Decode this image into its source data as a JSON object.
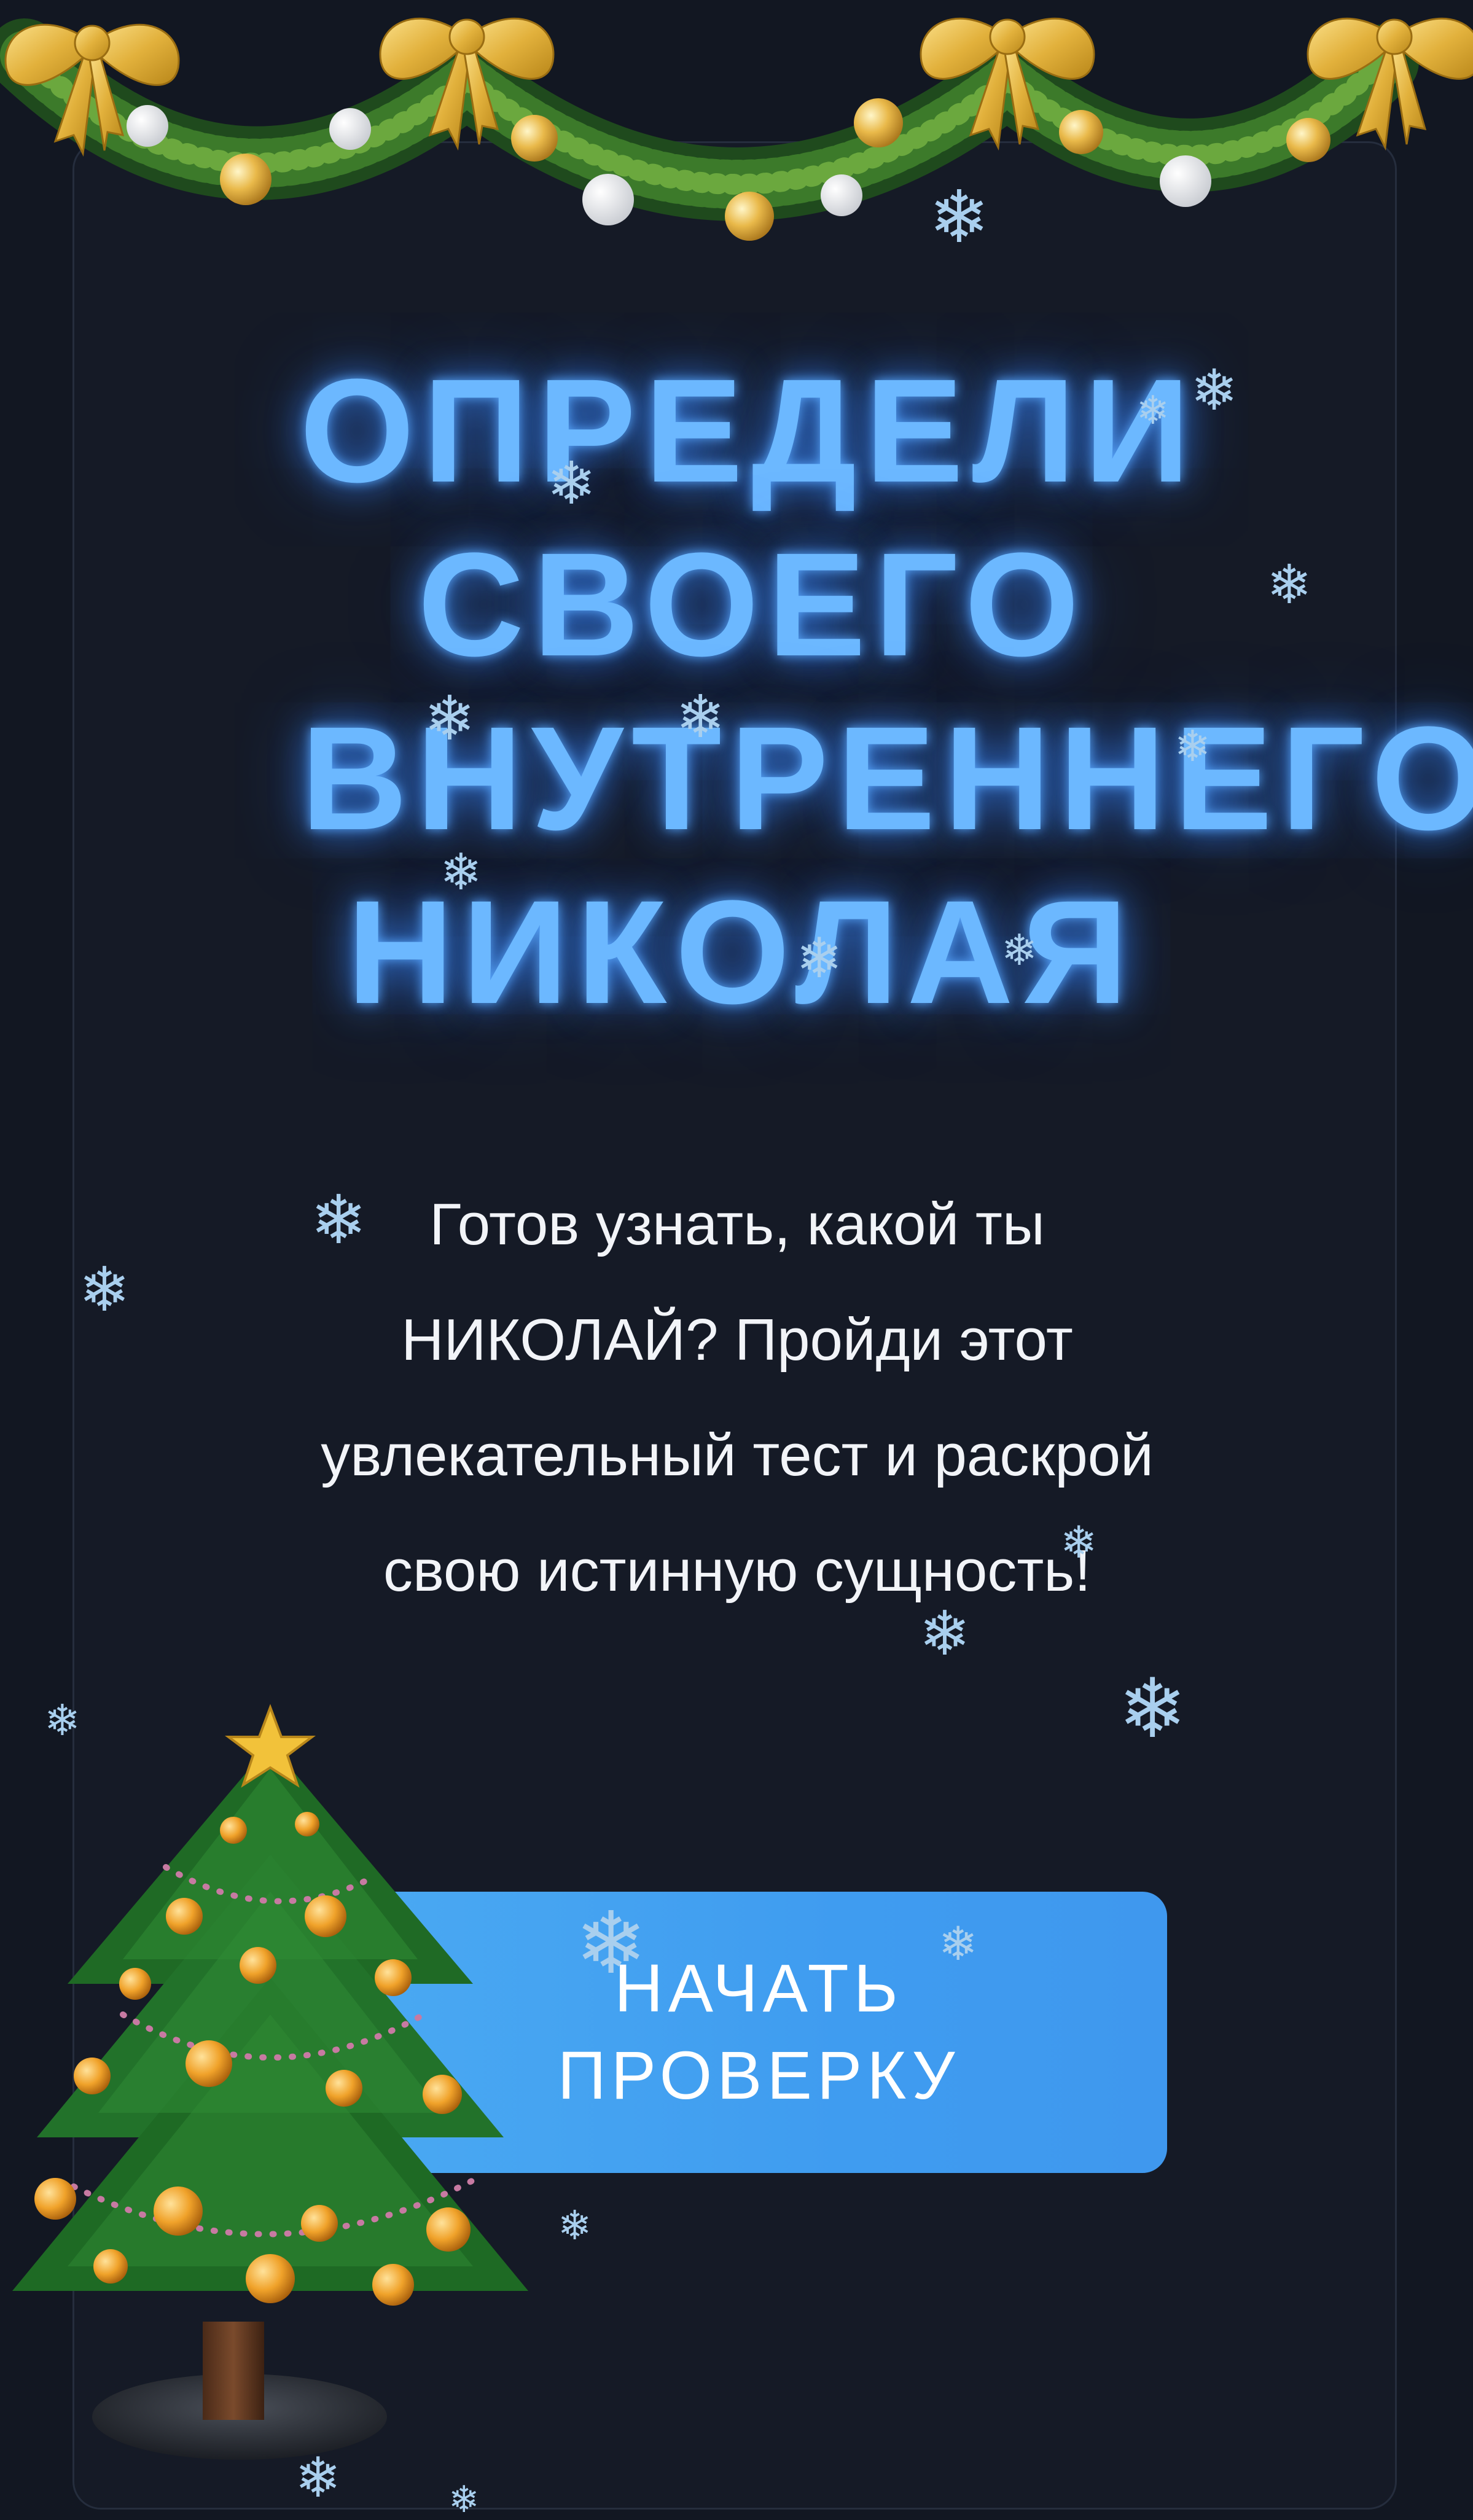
{
  "title_lines": [
    "ОПРЕДЕЛИ",
    "СВОЕГО",
    "ВНУТРЕННЕГО",
    "НИКОЛАЯ"
  ],
  "description": "Готов узнать, какой ты НИКОЛАЙ? Пройди этот увлекательный тест и раскрой свою истинную сущность!",
  "cta": {
    "lines": [
      "НАЧАТЬ",
      "ПРОВЕРКУ"
    ]
  },
  "icons": {
    "snowflake": "❄",
    "garland": "christmas-garland-with-bows-and-baubles",
    "tree": "christmas-tree"
  },
  "colors": {
    "background": "#121722",
    "panel": "#151a26",
    "title_glow": "#6cb8ff",
    "button": "#4aa9f2",
    "text": "#f2f4f8"
  }
}
